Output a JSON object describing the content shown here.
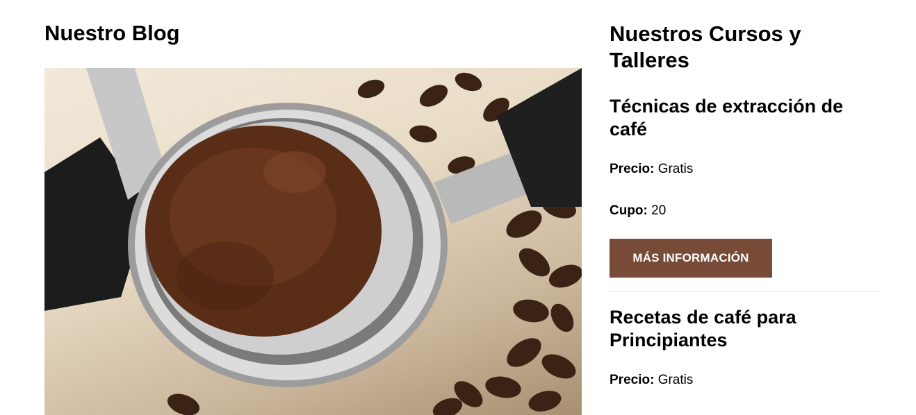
{
  "blog": {
    "title": "Nuestro Blog"
  },
  "courses": {
    "title": "Nuestros Cursos y Talleres",
    "items": [
      {
        "name": "Técnicas de extracción de café",
        "price_label": "Precio:",
        "price_value": "Gratis",
        "cupo_label": "Cupo:",
        "cupo_value": "20",
        "button_label": "Más información"
      },
      {
        "name": "Recetas de café para Principiantes",
        "price_label": "Precio:",
        "price_value": "Gratis"
      }
    ]
  },
  "colors": {
    "button_bg": "#784b38"
  }
}
